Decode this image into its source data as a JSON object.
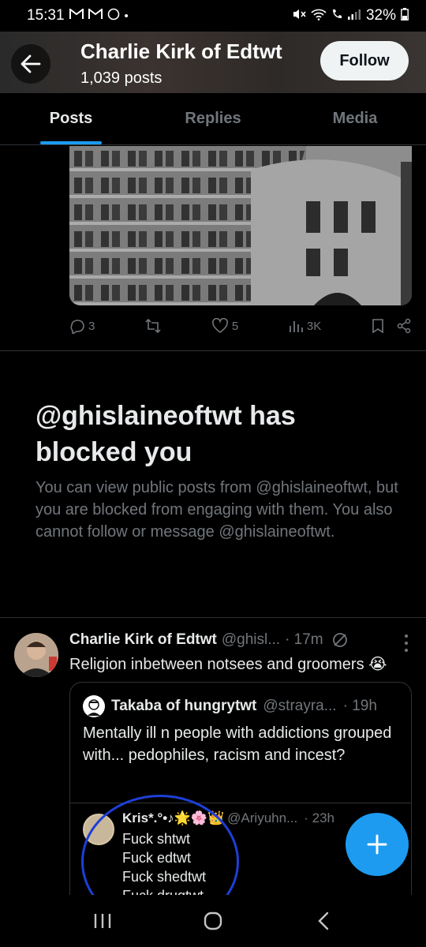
{
  "status": {
    "time": "15:31",
    "battery": "32%"
  },
  "header": {
    "title": "Charlie Kirk of Edtwt",
    "posts": "1,039 posts",
    "follow_label": "Follow"
  },
  "tabs": [
    {
      "label": "Posts"
    },
    {
      "label": "Replies"
    },
    {
      "label": "Media"
    }
  ],
  "post_actions": {
    "replies": "3",
    "likes": "5",
    "views": "3K"
  },
  "blocked": {
    "title": "@ghislaineoftwt has blocked you",
    "description": "You can view public posts from @ghislaineoftwt, but you are blocked from engaging with them. You also cannot follow or message @ghislaineoftwt."
  },
  "tweet": {
    "name": "Charlie Kirk of Edtwt",
    "handle": "@ghisl...",
    "time": "· 17m",
    "text": "Religion inbetween notsees and groomers 😭"
  },
  "quote": {
    "name": "Takaba of hungrytwt",
    "handle": "@strayra...",
    "time": "· 19h",
    "text": "Mentally ill n people with addictions grouped with... pedophiles, racism and incest?"
  },
  "inner": {
    "name": "Kris*.°•♪🌟🌸👑",
    "handle": "@Ariyuhn...",
    "time": "· 23h",
    "lines": [
      "Fuck shtwt",
      "Fuck edtwt",
      "Fuck shedtwt",
      "Fuck drugtwt"
    ]
  },
  "colors": {
    "accent": "#1d9bf0",
    "background": "#000000",
    "muted": "#71767b"
  }
}
